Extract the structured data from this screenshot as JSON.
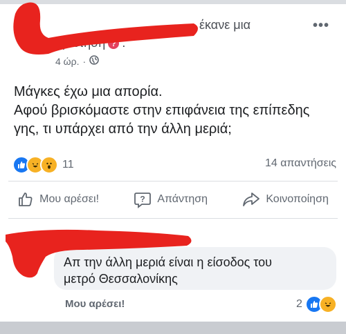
{
  "post": {
    "header_suffix": "έκανε μια",
    "header_line2": "ερώτηση",
    "question_badge": "?",
    "header_dot": ".",
    "time": "4 ώρ.",
    "time_sep": "·",
    "more_icon": "•••",
    "text_lines": [
      "Μάγκες έχω μια απορία.",
      "Αφού βρισκόμαστε στην επιφάνεια της επίπεδης",
      "γης, τι υπάρχει από την άλλη μεριά;"
    ],
    "reaction_count": "11",
    "answers_count": "14 απαντήσεις"
  },
  "actions": {
    "like_label": "Μου αρέσει!",
    "answer_label": "Απάντηση",
    "share_label": "Κοινοποίηση"
  },
  "comment": {
    "text_lines": [
      "Απ την άλλη μεριά είναι η είσοδος του",
      "μετρό Θεσσαλονίκης"
    ],
    "like_label": "Μου αρέσει!",
    "reaction_count": "2"
  },
  "colors": {
    "like_blue": "#1877f2",
    "emoji_yellow": "#f7b125",
    "redaction_red": "#e8231e"
  },
  "icons": [
    "like-reaction-icon",
    "haha-reaction-icon",
    "wow-reaction-icon",
    "globe-icon",
    "thumbs-up-icon",
    "question-bubble-icon",
    "share-arrow-icon",
    "more-options-icon"
  ]
}
